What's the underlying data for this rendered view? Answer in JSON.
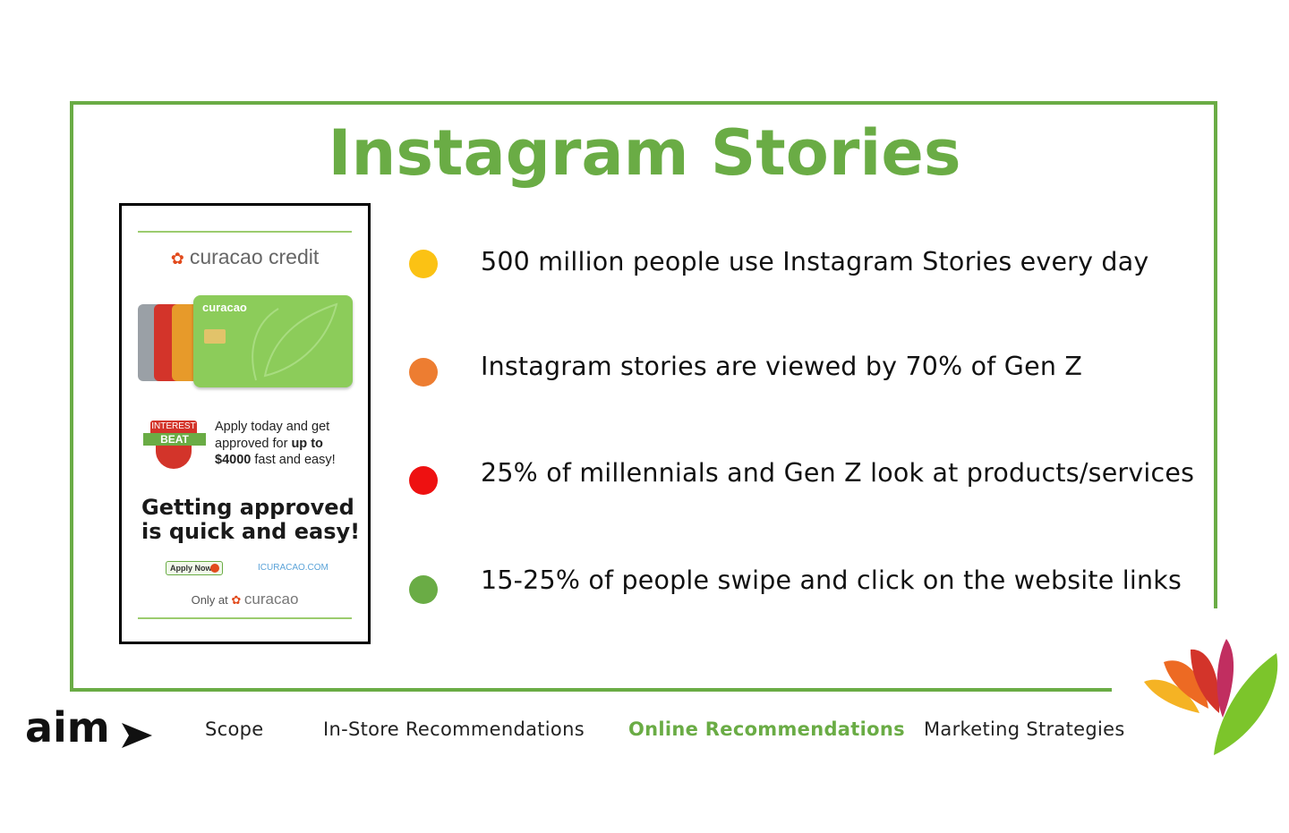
{
  "slide": {
    "title": "Instagram Stories",
    "accent_color": "#6aac45"
  },
  "ad": {
    "brand": "curacao credit",
    "card_name": "curacao",
    "badge": {
      "line1": "INTEREST",
      "line2": "BEAT"
    },
    "apply_line1": "Apply today and get",
    "apply_line2a": "approved for ",
    "apply_line2b": "up to",
    "apply_line3a": "$4000",
    "apply_line3b": " fast and easy!",
    "tagline_line1": "Getting approved",
    "tagline_line2": "is quick and easy!",
    "apply_button": "Apply Now",
    "website": "ICURACAO.COM",
    "only_at": "Only at",
    "only_brand": "curacao"
  },
  "bullets": [
    {
      "text": "500 million people use Instagram Stories every day",
      "color": "#fbc214"
    },
    {
      "text": "Instagram stories are viewed by 70% of Gen Z",
      "color": "#ed7d31"
    },
    {
      "text": "25% of millennials and Gen Z look at products/services",
      "color": "#ee1111"
    },
    {
      "text": "15-25% of people swipe and click on the website links",
      "color": "#6aac45"
    }
  ],
  "footer": {
    "logo_text": "aim",
    "nav": [
      {
        "label": "Scope",
        "active": false
      },
      {
        "label": "In-Store Recommendations",
        "active": false
      },
      {
        "label": "Online Recommendations",
        "active": true
      },
      {
        "label": "Marketing Strategies",
        "active": false
      }
    ]
  }
}
